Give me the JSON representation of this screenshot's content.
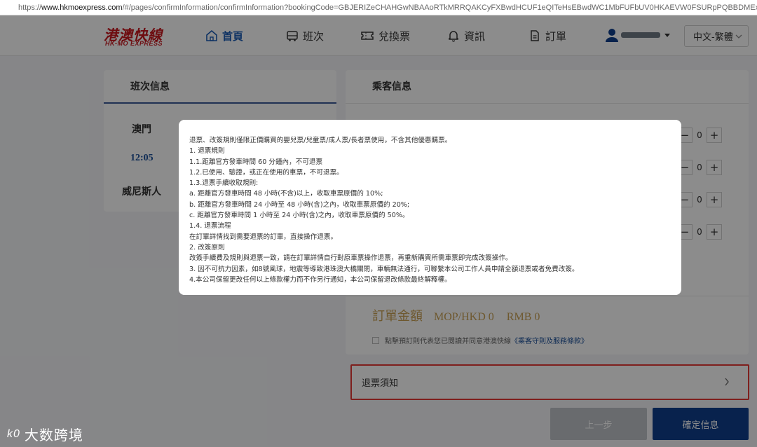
{
  "browser": {
    "url_prefix": "https://",
    "url_host": "www.hkmoexpress.com",
    "url_path": "/#/pages/confirmInformation/confirmInformation?bookingCode=GBJERIZeCHAHGwNBAAoRTkMRRQAKCyFXBwdHCUF1eQITeHsEBwdWC1MbFUFbUV0HKAEVW0FSURpPQBBDMExZTQpfXn"
  },
  "header": {
    "logo_cn": "港澳快線",
    "logo_en": "HK-MO EXPRESS",
    "nav": [
      {
        "label": "首頁",
        "icon": "home-icon"
      },
      {
        "label": "班次",
        "icon": "bus-icon"
      },
      {
        "label": "兌換票",
        "icon": "ticket-icon"
      },
      {
        "label": "資訊",
        "icon": "bell-icon"
      },
      {
        "label": "訂單",
        "icon": "document-icon"
      }
    ],
    "language": "中文-繁體"
  },
  "trip": {
    "title": "班次信息",
    "from": "澳門",
    "time": "12:05",
    "to": "威尼斯人"
  },
  "passenger": {
    "title": "乘客信息",
    "counts": [
      "0",
      "0",
      "0",
      "0"
    ],
    "amount_label": "訂單金額",
    "amount_hkd": "MOP/HKD 0",
    "amount_rmb": "RMB 0",
    "agree_text": "點擊預訂則代表您已閱讀并同意港澳快線",
    "agree_link": "《乘客守則及服務條款》"
  },
  "refund_row": {
    "label": "退票須知"
  },
  "buttons": {
    "prev": "上一步",
    "confirm": "確定信息"
  },
  "modal": {
    "lines": [
      "退票、改簽規則僅限正價購買的嬰兒票/兒童票/成人票/長者票使用，不含其他優惠購票。",
      "1. 退票規則",
      "1.1.距離官方發車時間 60 分鐘內，不可退票",
      "1.2.已使用、驗證，或正在使用的車票，不可退票。",
      "1.3.退票手續收取規則:",
      "a. 距離官方發車時間 48 小時(不含)以上，收取車票原價的 10%;",
      "b. 距離官方發車時間 24 小時至 48 小時(含)之內，收取車票原價的 20%;",
      "c. 距離官方發車時間 1 小時至 24 小時(含)之內，收取車票原價的 50%。",
      "1.4. 退票流程",
      "在訂單詳情找到需要退票的訂單，直接操作退票。",
      "2. 改簽原則",
      "改簽手續費及規則與退票一致，請在訂單詳情自行對原車票操作退票，再重新購買所需車票即完成改簽操作。",
      "3. 因不可抗力因素，如8號風球，地震等導致港珠澳大橋關閉，車輛無法通行，可聯繫本公司工作人員申請全額退票或者免費改簽。",
      "4.本公司保留更改任何以上條款權力而不作另行通知，本公司保留退改條款最終解釋權。"
    ]
  },
  "watermark": {
    "mark": "k0",
    "text": "大数跨境"
  },
  "colors": {
    "brand_red": "#c8171e",
    "nav_active": "#1a5bb5",
    "confirm_blue": "#0f3f8c",
    "highlight": "#e53935",
    "amount_gold": "#c8a055"
  }
}
